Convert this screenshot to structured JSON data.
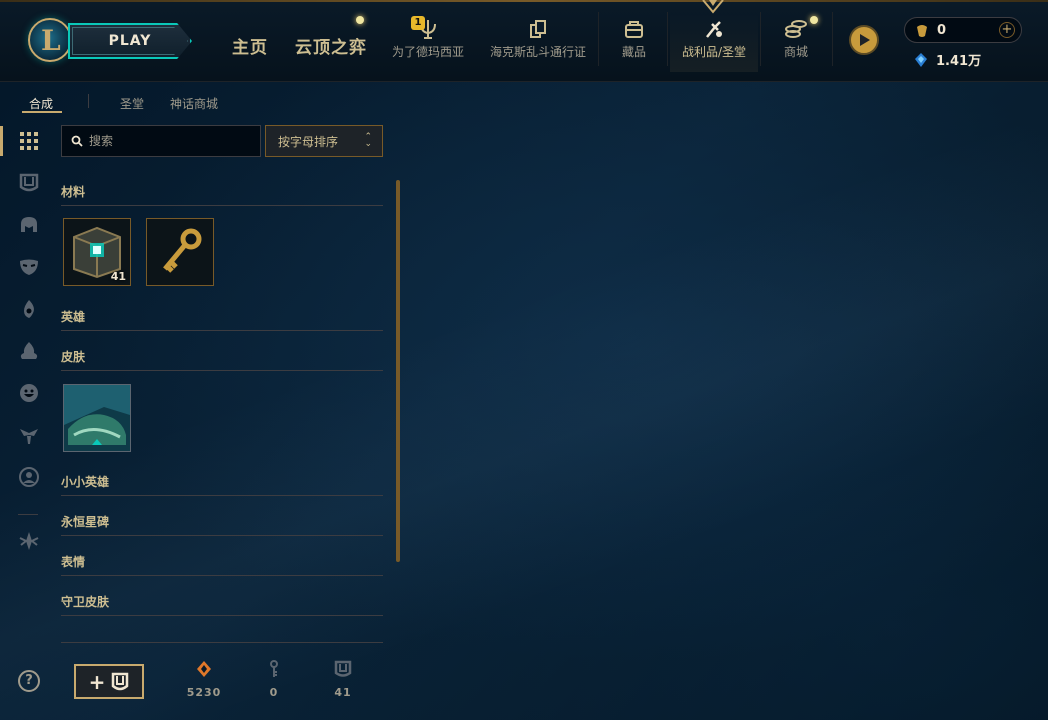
{
  "topbar": {
    "play_label": "PLAY",
    "home_label": "主页",
    "tft_label": "云顶之弈",
    "nav": [
      {
        "label": "为了德玛西亚",
        "icon": "demacia-event-icon",
        "badge": "1"
      },
      {
        "label": "海克斯乱斗通行证",
        "icon": "pass-icon"
      },
      {
        "label": "藏品",
        "icon": "collection-bag-icon"
      },
      {
        "label": "战利品/圣堂",
        "icon": "loot-icon"
      },
      {
        "label": "商城",
        "icon": "store-coins-icon"
      }
    ],
    "active_nav": "战利品/圣堂",
    "rp_amount": "0",
    "be_amount": "1.41万"
  },
  "subtabs": [
    {
      "label": "合成",
      "active": true
    },
    {
      "label": "圣堂",
      "active": false
    },
    {
      "label": "神话商城",
      "active": false
    }
  ],
  "sidebar": {
    "icons": [
      "all-grid-icon",
      "chest-icon",
      "helmet-icon",
      "mask-skin-icon",
      "flame-ward-icon",
      "emote-fire-icon",
      "smiley-emote-icon",
      "eternals-icon",
      "profile-icon-icon",
      "hextech-icon"
    ],
    "help_label": "?"
  },
  "search": {
    "placeholder": "搜索",
    "value": ""
  },
  "sort": {
    "label": "按字母排序"
  },
  "categories": [
    {
      "name": "材料",
      "items": [
        {
          "name": "hextech-chest-item",
          "count": "41"
        },
        {
          "name": "key-fragment-item",
          "count": ""
        }
      ]
    },
    {
      "name": "英雄",
      "items": []
    },
    {
      "name": "皮肤",
      "items": [
        {
          "name": "skin-shard-item",
          "count": ""
        }
      ]
    },
    {
      "name": "小小英雄",
      "items": []
    },
    {
      "name": "永恒星碑",
      "items": []
    },
    {
      "name": "表情",
      "items": []
    },
    {
      "name": "守卫皮肤",
      "items": []
    }
  ],
  "bottom": {
    "craft_plus": "+",
    "orange_essence": "5230",
    "keys": "0",
    "chests": "41"
  },
  "colors": {
    "gold": "#c8aa6e",
    "gold_dark": "#785a28",
    "text": "#a09b8c",
    "text_light": "#f0e6d2",
    "teal": "#0ac8b9",
    "bg": "#010a13"
  }
}
